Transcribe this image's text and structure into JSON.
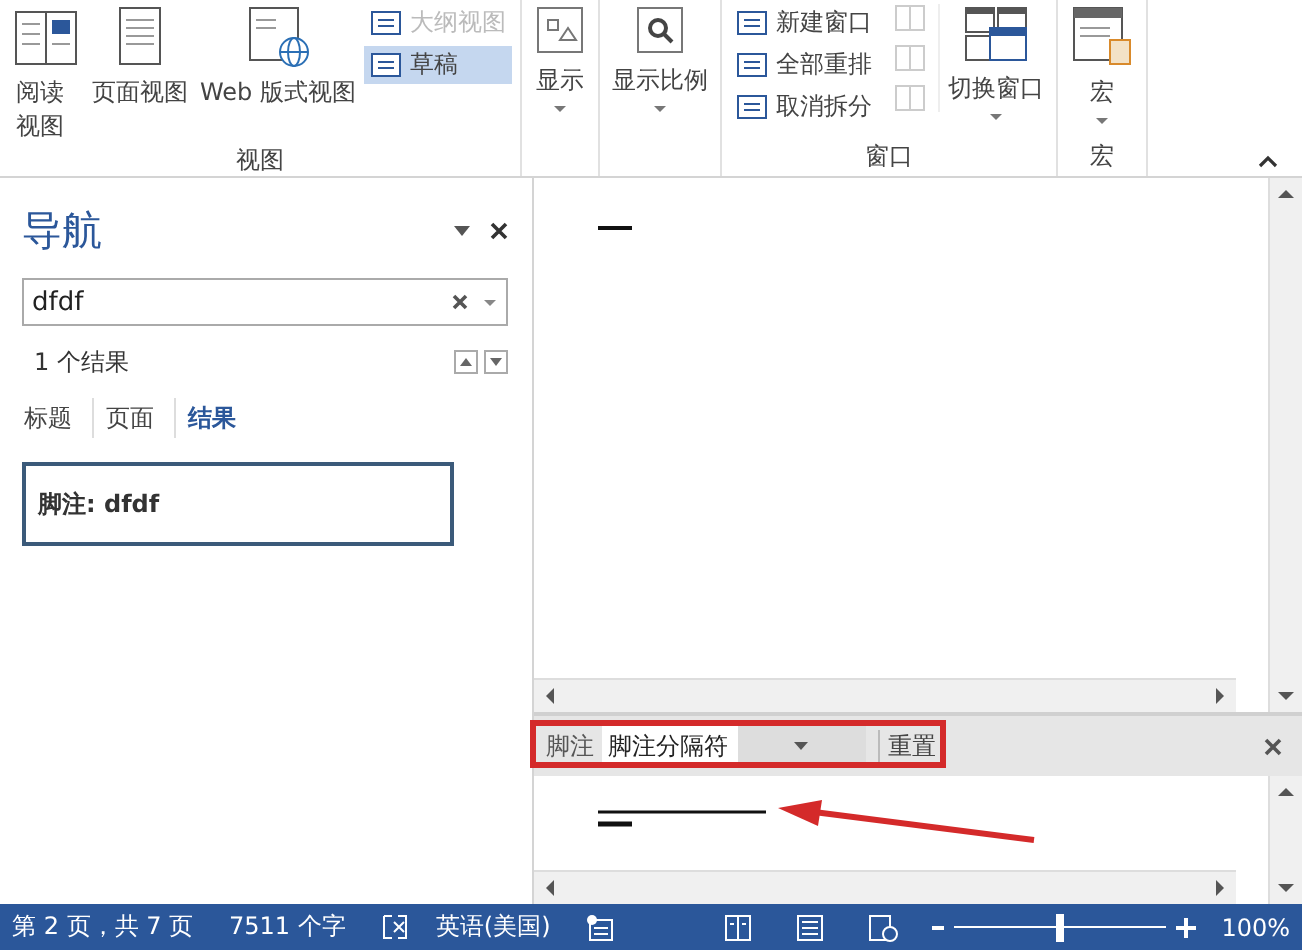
{
  "ribbon": {
    "groups": [
      {
        "label": "视图",
        "items": [
          {
            "kind": "large",
            "label": "阅读视图",
            "selected": false
          },
          {
            "kind": "large",
            "label": "页面视图",
            "selected": false
          },
          {
            "kind": "large",
            "label": "Web 版式视图",
            "selected": false
          },
          {
            "kind": "stack",
            "entries": [
              {
                "label": "大纲视图",
                "selected": false,
                "disabled": true
              },
              {
                "label": "草稿",
                "selected": true,
                "disabled": false
              }
            ]
          }
        ]
      },
      {
        "items": [
          {
            "kind": "dropdown",
            "label": "显示"
          }
        ]
      },
      {
        "items": [
          {
            "kind": "dropdown",
            "label": "显示比例"
          }
        ]
      },
      {
        "label": "窗口",
        "items": [
          {
            "kind": "stack",
            "entries": [
              {
                "label": "新建窗口",
                "selected": false,
                "disabled": false
              },
              {
                "label": "全部重排",
                "selected": false,
                "disabled": false
              },
              {
                "label": "取消拆分",
                "selected": false,
                "disabled": false
              }
            ]
          },
          {
            "kind": "icons"
          },
          {
            "kind": "dropdown",
            "label": "切换窗口"
          }
        ]
      },
      {
        "label": "宏",
        "items": [
          {
            "kind": "dropdown",
            "label": "宏"
          }
        ]
      }
    ]
  },
  "nav": {
    "title": "导航",
    "search": {
      "value": "dfdf"
    },
    "result_count": "1 个结果",
    "tabs": [
      {
        "label": "标题",
        "selected": false
      },
      {
        "label": "页面",
        "selected": false
      },
      {
        "label": "结果",
        "selected": true
      }
    ],
    "results": [
      "脚注: dfdf"
    ]
  },
  "footnote_bar": {
    "label": "脚注",
    "dropdown": {
      "value": "脚注分隔符"
    },
    "button": "重置"
  },
  "status_bar": {
    "page": "第 2 页，共 7 页",
    "words": "7511 个字",
    "language": "英语(美国)",
    "zoom": {
      "level": 0.5
    },
    "zoom_reading": "100%"
  }
}
